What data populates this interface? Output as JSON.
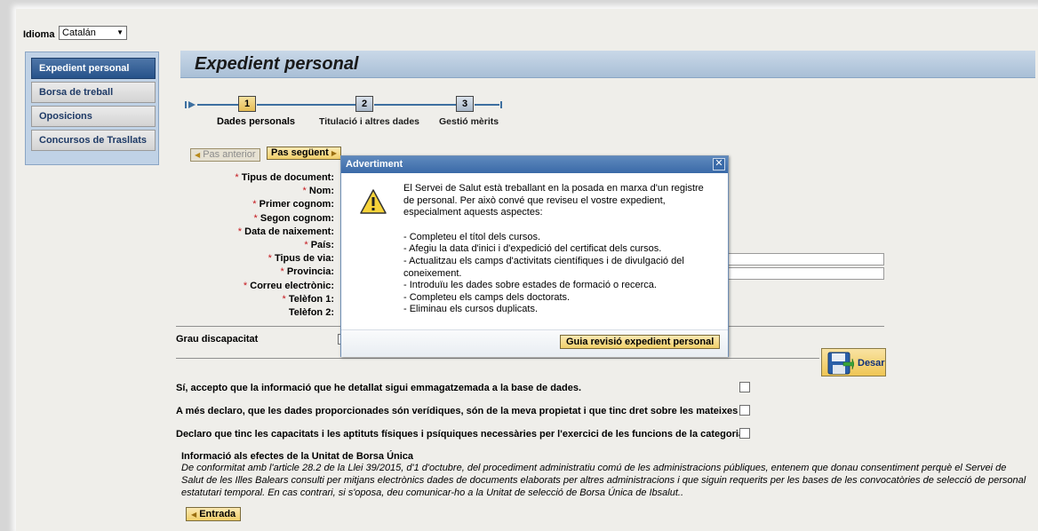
{
  "language": {
    "label": "Idioma",
    "selected": "Catalán"
  },
  "sidebar": {
    "items": [
      {
        "label": "Expedient personal",
        "active": true
      },
      {
        "label": "Borsa de treball",
        "active": false
      },
      {
        "label": "Oposicions",
        "active": false
      },
      {
        "label": "Concursos de Trasllats",
        "active": false
      }
    ]
  },
  "header": {
    "title": "Expedient personal"
  },
  "steps": [
    {
      "number": "1",
      "label": "Dades personals",
      "active": true
    },
    {
      "number": "2",
      "label": "Titulació i altres dades",
      "active": false
    },
    {
      "number": "3",
      "label": "Gestió mèrits",
      "active": false
    }
  ],
  "nav": {
    "prev_label": "Pas anterior",
    "next_label": "Pas següent"
  },
  "form": {
    "required_mark": "*",
    "fields": [
      {
        "label": "Tipus de document:",
        "required": true
      },
      {
        "label": "Nom:",
        "required": true
      },
      {
        "label": "Primer cognom:",
        "required": true
      },
      {
        "label": "Segon cognom:",
        "required": true
      },
      {
        "label": "Data de naixement:",
        "required": true
      },
      {
        "label": "País:",
        "required": true
      },
      {
        "label": "Tipus de via:",
        "required": true
      },
      {
        "label": "Provincia:",
        "required": true
      },
      {
        "label": "Correu electrònic:",
        "required": true
      },
      {
        "label": "Telèfon 1:",
        "required": true
      },
      {
        "label": "Telèfon 2:",
        "required": false
      }
    ],
    "disability_label": "Grau discapacitat"
  },
  "save": {
    "label": "Desar"
  },
  "consents": [
    "Sí, accepto que la informació que he detallat sigui emmagatzemada a la base de dades.",
    "A més declaro, que les dades proporcionades són verídiques, són de la meva propietat i que tinc dret sobre les mateixes",
    "Declaro que tinc les capacitats i les aptituts físiques i psíquiques necessàries per l'exercici de les funcions de la categoria"
  ],
  "info": {
    "title": "Informació als efectes de la Unitat de Borsa Única",
    "text": "De conformitat amb l'article 28.2 de la Llei 39/2015, d'1 d'octubre, del procediment administratiu comú de les administracions públiques, entenem que donau consentiment perquè el Servei de Salut de les Illes Balears consulti per mitjans electrònics dades de documents elaborats per altres administracions i que siguin requerits per les bases de les convocatòries de selecció de personal estatutari temporal. En cas contrari, si s'oposa, deu comunicar-ho a la Unitat de selecció de Borsa Única de Ibsalut.."
  },
  "entrada": {
    "label": "Entrada"
  },
  "dialog": {
    "title": "Advertiment",
    "close": "✕",
    "intro": "El Servei de Salut està treballant en la posada en marxa d'un registre de personal. Per això convé que reviseu el vostre expedient, especialment aquests aspectes:",
    "items": [
      "- Completeu el títol dels cursos.",
      "- Afegiu la data d'inici i d'expedició del certificat dels cursos.",
      "- Actualitzau els camps d'activitats científiques i de divulgació del coneixement.",
      "- Introduïu les dades sobre estades de formació o recerca.",
      "- Completeu els camps dels doctorats.",
      "- Eliminau els cursos duplicats."
    ],
    "button": "Guia revisió expedient personal"
  }
}
